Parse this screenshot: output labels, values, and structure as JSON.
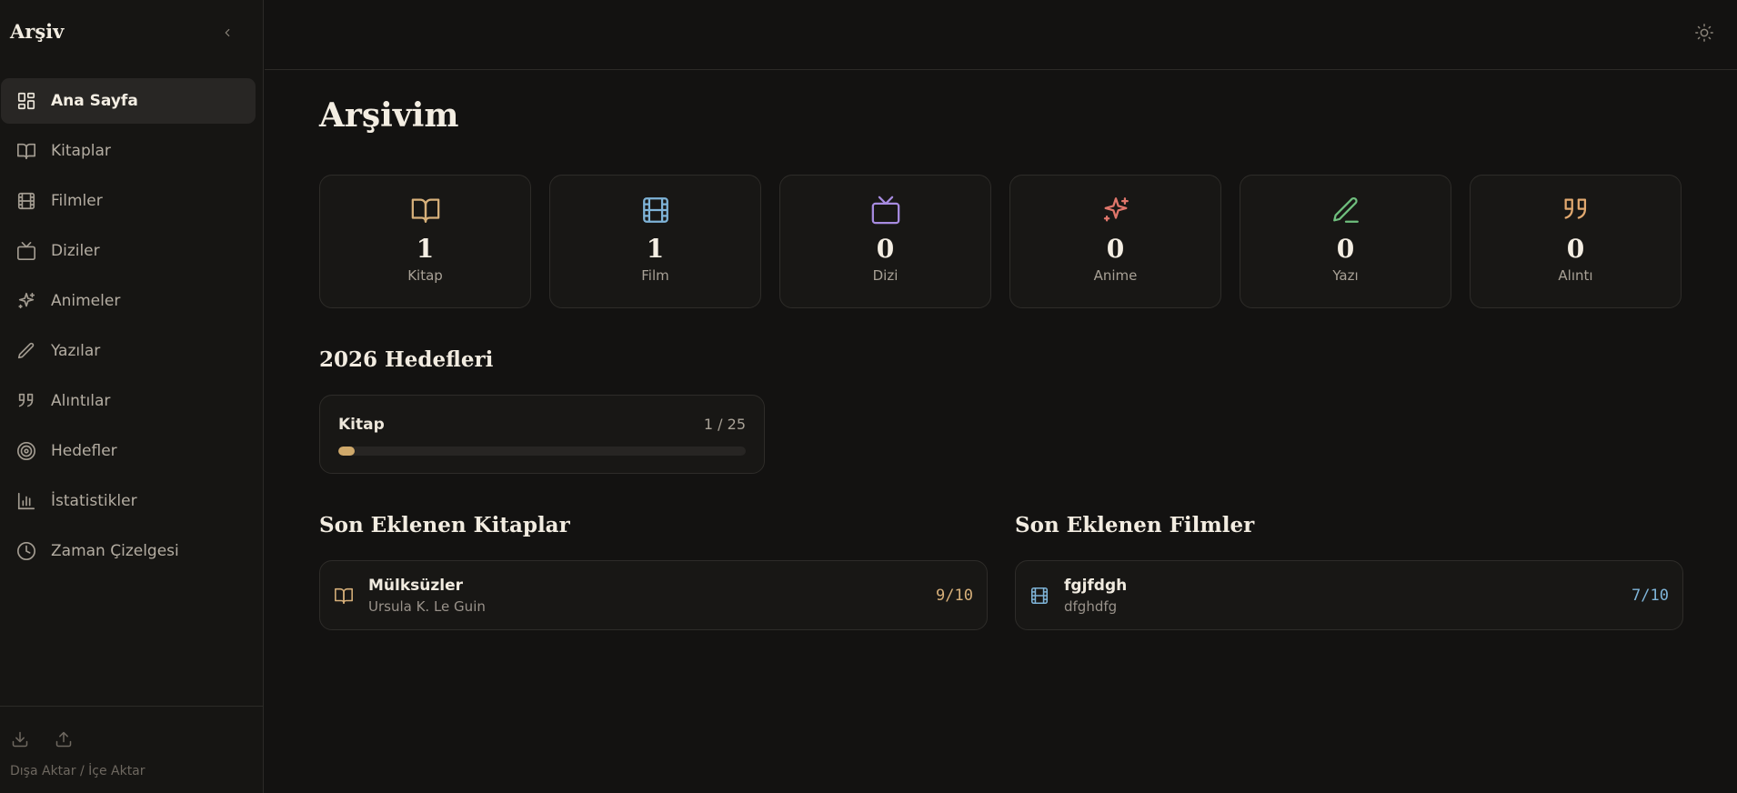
{
  "app": {
    "brand": "Arşiv"
  },
  "sidebar": {
    "items": [
      {
        "label": "Ana Sayfa",
        "icon": "dashboard-icon",
        "active": true
      },
      {
        "label": "Kitaplar",
        "icon": "book-icon"
      },
      {
        "label": "Filmler",
        "icon": "film-icon"
      },
      {
        "label": "Diziler",
        "icon": "tv-icon"
      },
      {
        "label": "Animeler",
        "icon": "sparkles-icon"
      },
      {
        "label": "Yazılar",
        "icon": "pen-icon"
      },
      {
        "label": "Alıntılar",
        "icon": "quote-icon"
      },
      {
        "label": "Hedefler",
        "icon": "target-icon"
      },
      {
        "label": "İstatistikler",
        "icon": "bar-chart-icon"
      },
      {
        "label": "Zaman Çizelgesi",
        "icon": "clock-icon"
      }
    ],
    "footer_label": "Dışa Aktar / İçe Aktar"
  },
  "main": {
    "title": "Arşivim",
    "stats": [
      {
        "value": "1",
        "label": "Kitap",
        "icon": "book-icon",
        "color": "#d7b07a"
      },
      {
        "value": "1",
        "label": "Film",
        "icon": "film-icon",
        "color": "#7fb4d8"
      },
      {
        "value": "0",
        "label": "Dizi",
        "icon": "tv-icon",
        "color": "#a78be0"
      },
      {
        "value": "0",
        "label": "Anime",
        "icon": "sparkles-icon",
        "color": "#e0766b"
      },
      {
        "value": "0",
        "label": "Yazı",
        "icon": "pen-icon",
        "color": "#6fbf7e"
      },
      {
        "value": "0",
        "label": "Alıntı",
        "icon": "quote-icon",
        "color": "#e0a86f"
      }
    ],
    "goals_title": "2026 Hedefleri",
    "goal": {
      "name": "Kitap",
      "count": "1 / 25",
      "progress": 0.04,
      "color": "#cfa96b"
    },
    "recent_books_title": "Son Eklenen Kitaplar",
    "recent_book": {
      "title": "Mülksüzler",
      "author": "Ursula K. Le Guin",
      "rating": "9/10",
      "color": "#d7b07a"
    },
    "recent_films_title": "Son Eklenen Filmler",
    "recent_film": {
      "title": "fgjfdgh",
      "director": "dfghdfg",
      "rating": "7/10",
      "color": "#7fb4d8"
    }
  }
}
